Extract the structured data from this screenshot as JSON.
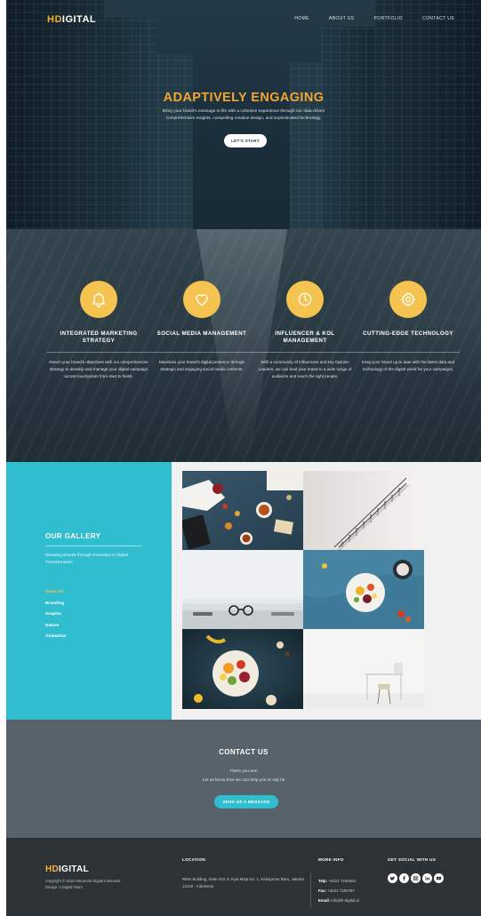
{
  "header": {
    "logo": {
      "accent": "HD",
      "rest": "IGITAL"
    },
    "nav": [
      "HOME",
      "ABOUT US",
      "PORTFOLIO",
      "CONTACT US"
    ]
  },
  "hero": {
    "title": "ADAPTIVELY ENGAGING",
    "text": "Bring your brand's message to life with a cohesive experience through our data-driven comprehensive insights, compelling creative design, and sophisticated technology.",
    "cta": "LET'S START"
  },
  "services": [
    {
      "icon": "bell-icon",
      "title": "INTEGRATED MARKETING STRATEGY",
      "desc": "Reach your brand's objectives with our comprehensive strategy to develop and manage your digital campaign across touchpoints from start to finish."
    },
    {
      "icon": "heart-icon",
      "title": "SOCIAL MEDIA MANAGEMENT",
      "desc": "Maximize your brand's digital presence through strategic and engaging social media contents."
    },
    {
      "icon": "clock-icon",
      "title": "INFLUENCER & KOL MANAGEMENT",
      "desc": "With a community of influencers and key Opinion Leaders, we can lead your brand to a wide range of audience and reach the right people."
    },
    {
      "icon": "gear-icon",
      "title": "CUTTING-EDGE TECHNOLOGY",
      "desc": "Keep your brand up to date with the latest data and technology of the digital world for your campaigns."
    }
  ],
  "gallery": {
    "title": "OUR GALLERY",
    "tagline": "Elevating Brands through Innovation in Digital Transformation",
    "filters": [
      "Show All",
      "Branding",
      "Graphic",
      "Nature",
      "Animation"
    ]
  },
  "contact": {
    "title": "CONTACT US",
    "line1": "There you are!",
    "line2": "Let us know how we can help you or say hi!",
    "cta": "SEND US A MESSAGE"
  },
  "footer": {
    "logo": {
      "accent": "HD",
      "rest": "IGITAL"
    },
    "copyright": "Copyright © 2016 Harumoto Digital Indonesia",
    "credit": "Design: A Digital Team",
    "location_heading": "LOCATION",
    "location_text": "RMG Building, Suite 010 Jl. Kyai Maja No. 1, Kebayoran Baru, Jakarta 12120 - Indonesia",
    "more_heading": "MORE INFO",
    "phone_label": "Telp:",
    "phone": "+6221 7245302",
    "fax_label": "Fax:",
    "fax": "+6221 7205787",
    "email_label": "Email:",
    "email": "info@h-digital.id",
    "social_heading": "GET SOCIAL WITH US",
    "social": [
      "twitter-icon",
      "facebook-icon",
      "instagram-icon",
      "linkedin-icon",
      "youtube-icon"
    ]
  },
  "colors": {
    "accent": "#f2b233",
    "teal": "#2fbdcf",
    "contact_bg": "#57626a",
    "footer_bg": "#2d3236"
  }
}
